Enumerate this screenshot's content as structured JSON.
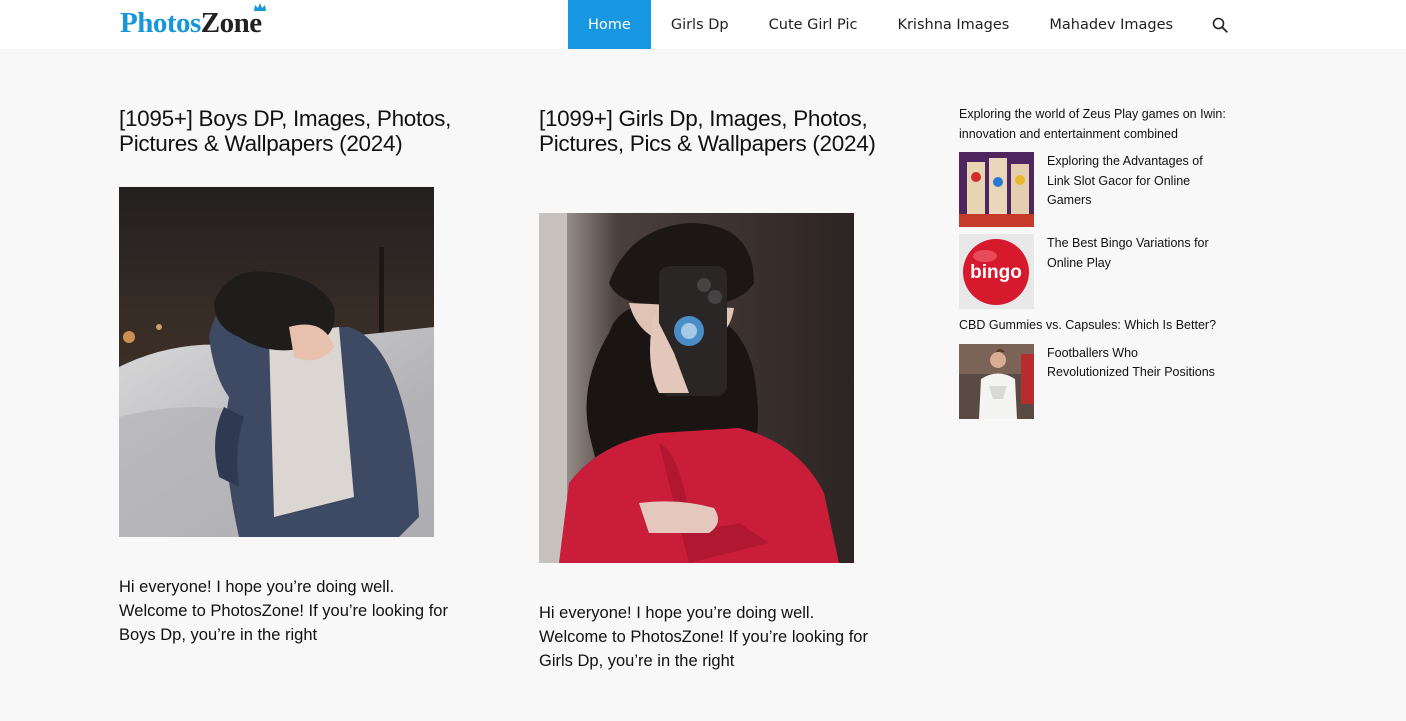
{
  "site": {
    "logo_part1": "Photos",
    "logo_part2": "Zone"
  },
  "nav": {
    "items": [
      {
        "label": "Home",
        "active": true
      },
      {
        "label": "Girls Dp",
        "active": false
      },
      {
        "label": "Cute Girl Pic",
        "active": false
      },
      {
        "label": "Krishna Images",
        "active": false
      },
      {
        "label": "Mahadev Images",
        "active": false
      }
    ],
    "search_icon": "search-icon"
  },
  "posts": [
    {
      "title": "[1095+] Boys DP, Images, Photos, Pictures & Wallpapers (2024)",
      "excerpt": "Hi everyone! I hope you’re doing well. Welcome to PhotosZone! If you’re looking for Boys Dp, you’re in the right"
    },
    {
      "title": "[1099+] Girls Dp, Images, Photos, Pictures, Pics & Wallpapers (2024)",
      "excerpt": "Hi everyone! I hope you’re doing well. Welcome to PhotosZone! If you’re looking for Girls Dp, you’re in the right"
    }
  ],
  "sidebar": {
    "items": [
      {
        "title": "Exploring the world of Zeus Play games on Iwin: innovation and entertainment combined",
        "has_image": false
      },
      {
        "title": "Exploring the Advantages of Link Slot Gacor for Online Gamers",
        "has_image": true
      },
      {
        "title": "The Best Bingo Variations for Online Play",
        "has_image": true,
        "image_text": "bingo"
      },
      {
        "title": "CBD Gummies vs. Capsules: Which Is Better?",
        "has_image": false
      },
      {
        "title": "Footballers Who Revolutionized Their Positions",
        "has_image": true,
        "image_text": "Fly Emirates"
      }
    ]
  },
  "colors": {
    "brand_blue": "#1796d8",
    "nav_active": "#1796e2",
    "page_bg": "#f8f8f8"
  }
}
